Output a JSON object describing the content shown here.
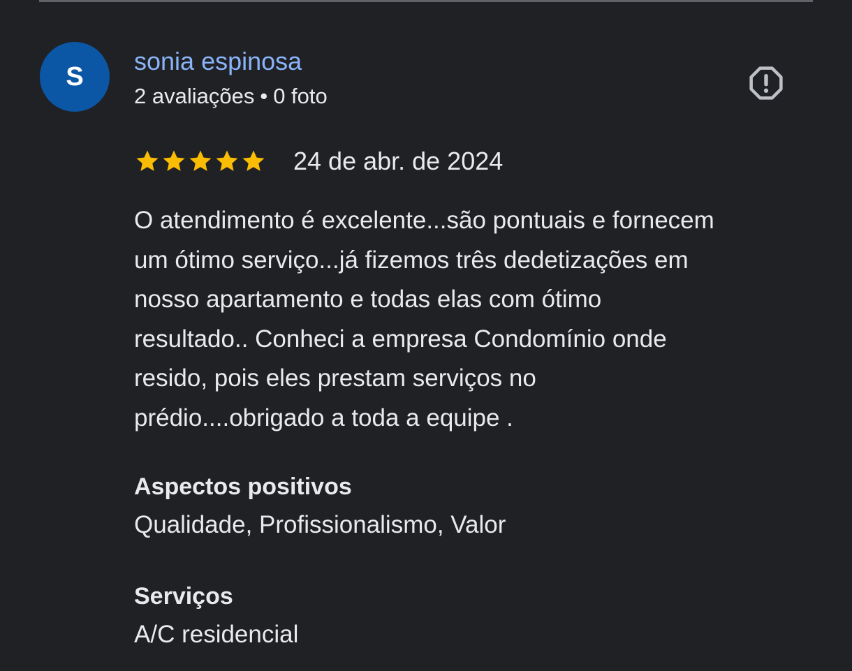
{
  "review": {
    "author": {
      "name": "sonia espinosa",
      "initial": "S",
      "reviews_count": "2 avaliações",
      "separator": "•",
      "photos_count": "0 foto",
      "avatar_color": "#0b57a6"
    },
    "rating": 5,
    "rating_max": 5,
    "star_color": "#fbbc04",
    "date": "24 de abr. de 2024",
    "text_lines": [
      "O atendimento é excelente...são pontuais e fornecem",
      "um ótimo serviço...já fizemos três dedetizações em",
      "nosso apartamento e todas elas com ótimo",
      "resultado.. Conheci a empresa Condomínio onde",
      "resido, pois eles prestam serviços no",
      "prédio....obrigado a toda a equipe ."
    ],
    "sections": [
      {
        "title": "Aspectos positivos",
        "value": "Qualidade, Profissionalismo, Valor"
      },
      {
        "title": "Serviços",
        "value": "A/C residencial"
      }
    ],
    "report_icon": "report-octagon-icon"
  },
  "theme": {
    "background": "#202124",
    "link_color": "#8ab4f8",
    "text_color": "#e8eaed",
    "icon_color": "#bdc1c6"
  }
}
